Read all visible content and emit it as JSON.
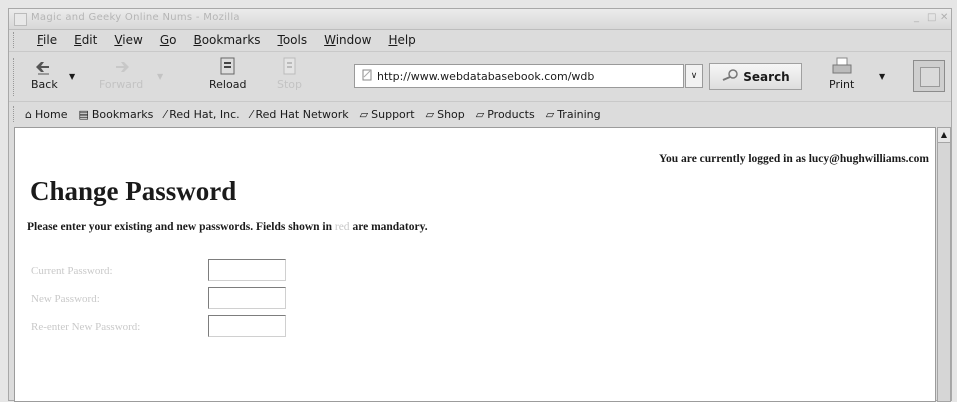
{
  "window": {
    "title": "Magic and Geeky Online Nums - Mozilla"
  },
  "menu": [
    "File",
    "Edit",
    "View",
    "Go",
    "Bookmarks",
    "Tools",
    "Window",
    "Help"
  ],
  "toolbar": {
    "back": "Back",
    "forward": "Forward",
    "reload": "Reload",
    "stop": "Stop",
    "url": "http://www.webdatabasebook.com/wdb",
    "search": "Search",
    "print": "Print"
  },
  "bookmarks": [
    "Home",
    "Bookmarks",
    "Red Hat, Inc.",
    "Red Hat Network",
    "Support",
    "Shop",
    "Products",
    "Training"
  ],
  "page": {
    "login_status": "You are currently logged in as lucy@hughwilliams.com",
    "heading": "Change Password",
    "instructions_pre": "Please enter your existing and new passwords. Fields shown in",
    "instructions_red": "red",
    "instructions_post": "are mandatory.",
    "fields": [
      {
        "label": "Current Password:",
        "value": ""
      },
      {
        "label": "New Password:",
        "value": ""
      },
      {
        "label": "Re-enter New Password:",
        "value": ""
      }
    ]
  },
  "colors": {
    "mandatory_label": "#c9c9c9",
    "chrome_bg": "#dcdcdc"
  }
}
